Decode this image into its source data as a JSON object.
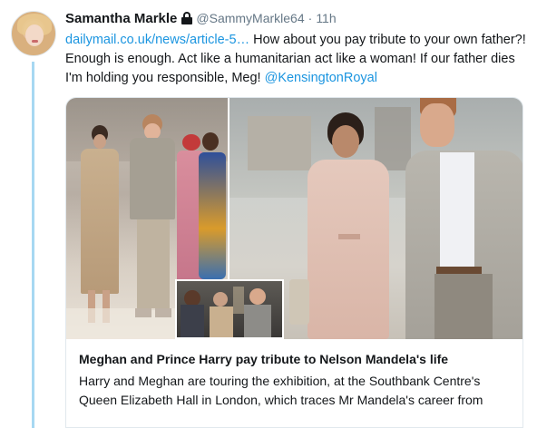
{
  "tweet": {
    "name": "Samantha Markle",
    "handle": "@SammyMarkle64",
    "separator": "·",
    "time": "11h",
    "link_text": "dailymail.co.uk/news/article-5…",
    "body_text": " How about you pay tribute to your own father?! Enough is enough. Act like a humanitarian act like a woman! If our father dies I'm holding you responsible, Meg! ",
    "mention": "@KensingtonRoyal",
    "icons": {
      "lock": "lock-icon",
      "avatar": "avatar"
    }
  },
  "card": {
    "title": "Meghan and Prince Harry pay tribute to Nelson Mandela's life",
    "description": "Harry and Meghan are touring the exhibition, at the Southbank Centre's Queen Elizabeth Hall in London, which traces Mr Mandela's career from"
  },
  "colors": {
    "link": "#1b95e0",
    "thread_line": "#a7d8f2",
    "text": "#14171a",
    "secondary": "#657786"
  }
}
